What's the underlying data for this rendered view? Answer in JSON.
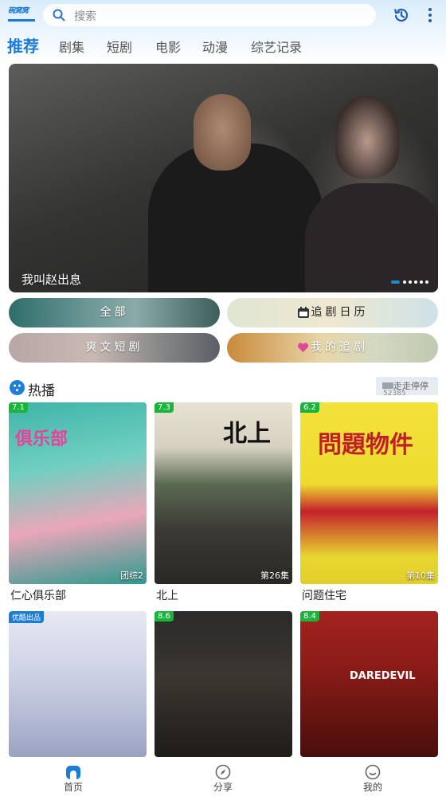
{
  "header": {
    "logo_text": "碗窝窝",
    "search_placeholder": "搜索"
  },
  "tabs": [
    {
      "label": "推荐",
      "active": true
    },
    {
      "label": "剧集"
    },
    {
      "label": "短剧"
    },
    {
      "label": "电影"
    },
    {
      "label": "动漫"
    },
    {
      "label": "综艺记录"
    }
  ],
  "banner": {
    "title": "我叫赵出息",
    "slide_count": 6,
    "active_slide": 1
  },
  "entries": [
    {
      "label": "全部"
    },
    {
      "label": "追剧日历"
    },
    {
      "label": "爽文短剧"
    },
    {
      "label": "我的追剧"
    }
  ],
  "section": {
    "title": "热播",
    "notice_text": "走走停停",
    "notice_sub": "52385"
  },
  "cards": [
    {
      "title": "仁心俱乐部",
      "score": "7.1",
      "episode": "团综2",
      "poster_text": "俱乐部"
    },
    {
      "title": "北上",
      "score": "7.3",
      "episode": "第26集",
      "poster_text": "北上"
    },
    {
      "title": "问题住宅",
      "score": "6.2",
      "episode": "第10集",
      "poster_text": "問題物件"
    },
    {
      "title": "",
      "score": "",
      "episode": "",
      "poster_text": "",
      "corner_tag": "优酷出品"
    },
    {
      "title": "",
      "score": "8.6",
      "episode": "",
      "poster_text": ""
    },
    {
      "title": "",
      "score": "8.4",
      "episode": "",
      "poster_text": "DAREDEVIL"
    }
  ],
  "bottom_nav": [
    {
      "label": "首页",
      "active": true
    },
    {
      "label": "分享"
    },
    {
      "label": "我的"
    }
  ],
  "colors": {
    "accent": "#1c7cd6",
    "score_badge": "#19b43a"
  }
}
